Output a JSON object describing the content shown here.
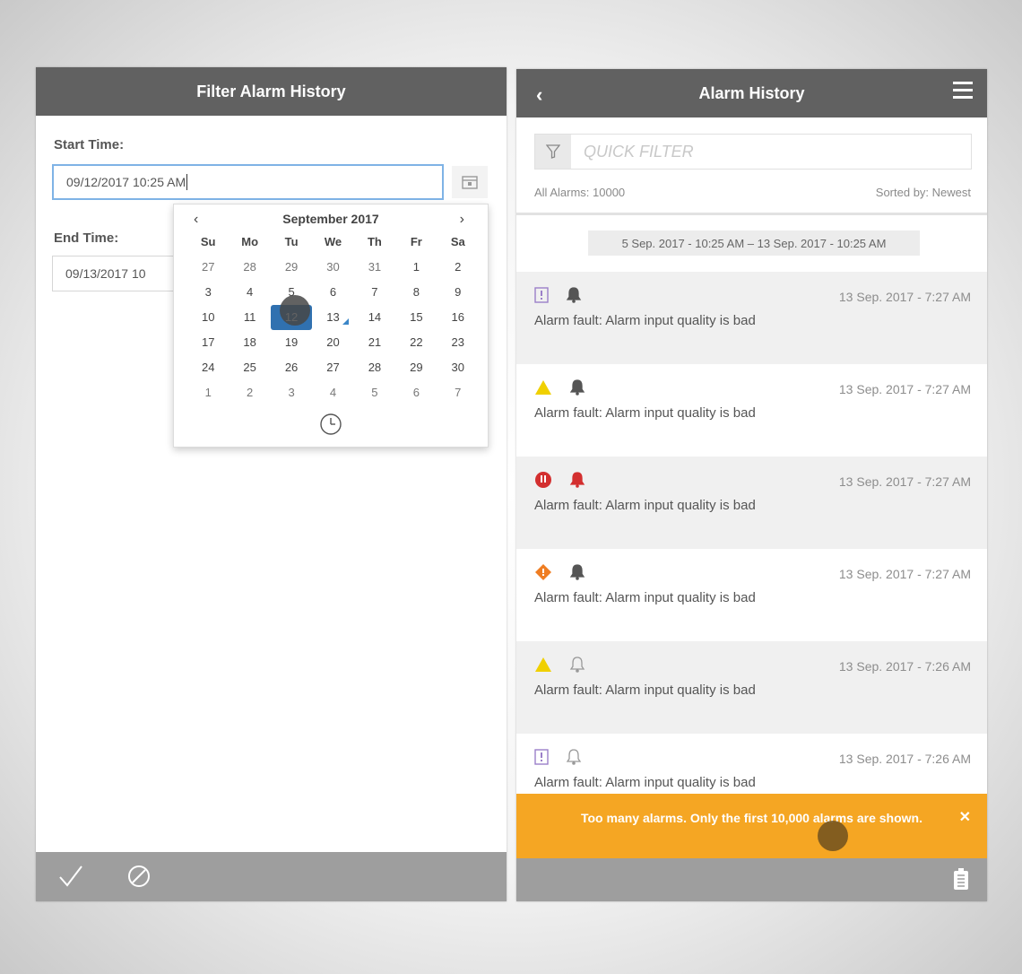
{
  "filter_panel": {
    "title": "Filter Alarm History",
    "start_label": "Start Time:",
    "start_value": "09/12/2017 10:25 AM",
    "end_label": "End Time:",
    "end_value": "09/13/2017 10",
    "calendar": {
      "month_title": "September 2017",
      "prev": "‹",
      "next": "›",
      "weekdays": [
        "Su",
        "Mo",
        "Tu",
        "We",
        "Th",
        "Fr",
        "Sa"
      ],
      "weeks": [
        [
          "27",
          "28",
          "29",
          "30",
          "31",
          "1",
          "2"
        ],
        [
          "3",
          "4",
          "5",
          "6",
          "7",
          "8",
          "9"
        ],
        [
          "10",
          "11",
          "12",
          "13",
          "14",
          "15",
          "16"
        ],
        [
          "17",
          "18",
          "19",
          "20",
          "21",
          "22",
          "23"
        ],
        [
          "24",
          "25",
          "26",
          "27",
          "28",
          "29",
          "30"
        ],
        [
          "1",
          "2",
          "3",
          "4",
          "5",
          "6",
          "7"
        ]
      ],
      "selected_day": "12",
      "today_day": "13"
    }
  },
  "history_panel": {
    "title": "Alarm History",
    "quick_filter_placeholder": "QUICK FILTER",
    "count_text": "All Alarms: 10000",
    "sort_text": "Sorted by: Newest",
    "date_range": "5 Sep. 2017 - 10:25 AM – 13 Sep. 2017 - 10:25 AM",
    "alarms": [
      {
        "severity_icon": "info-square-icon",
        "bell_icon": "bell-active-icon",
        "time": "13 Sep. 2017 - 7:27 AM",
        "message": "Alarm fault: Alarm input quality is bad"
      },
      {
        "severity_icon": "warning-triangle-icon",
        "bell_icon": "bell-active-icon",
        "time": "13 Sep. 2017 - 7:27 AM",
        "message": "Alarm fault: Alarm input quality is bad"
      },
      {
        "severity_icon": "critical-circle-icon",
        "bell_icon": "bell-alert-red-icon",
        "time": "13 Sep. 2017 - 7:27 AM",
        "message": "Alarm fault: Alarm input quality is bad"
      },
      {
        "severity_icon": "high-diamond-icon",
        "bell_icon": "bell-active-icon",
        "time": "13 Sep. 2017 - 7:27 AM",
        "message": "Alarm fault: Alarm input quality is bad"
      },
      {
        "severity_icon": "warning-triangle-icon",
        "bell_icon": "bell-outline-icon",
        "time": "13 Sep. 2017 - 7:26 AM",
        "message": "Alarm fault: Alarm input quality is bad"
      },
      {
        "severity_icon": "info-square-icon",
        "bell_icon": "bell-outline-icon",
        "time": "13 Sep. 2017 - 7:26 AM",
        "message": "Alarm fault: Alarm input quality is bad"
      }
    ],
    "toast_text": "Too many alarms. Only the first 10,000 alarms are shown.",
    "toast_close": "✕"
  },
  "colors": {
    "header": "#616161",
    "footer": "#9e9e9e",
    "selected_day": "#3071b0",
    "toast": "#f5a623",
    "critical": "#d32f2f",
    "warning": "#f0d000",
    "high": "#ef7d22",
    "info": "#9b7fc9"
  }
}
